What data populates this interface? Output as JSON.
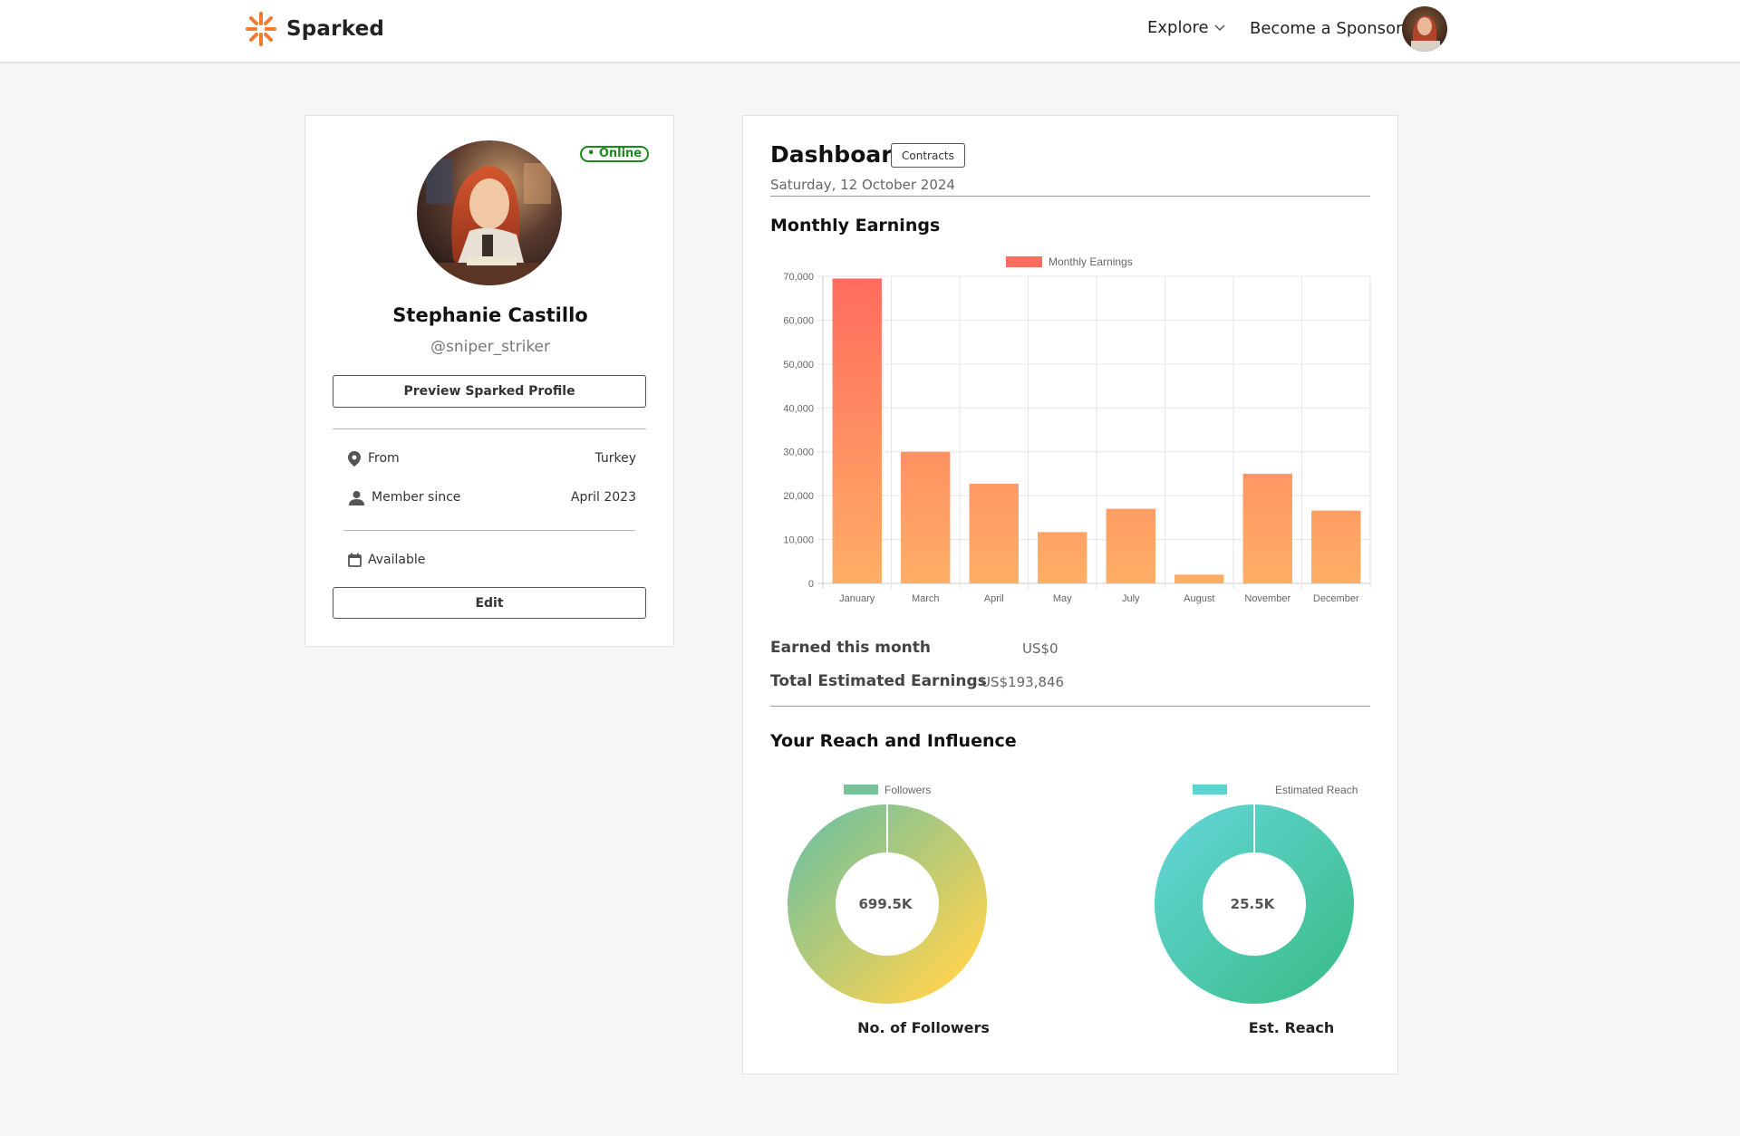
{
  "header": {
    "brand": "Sparked",
    "nav_explore": "Explore",
    "nav_sponsor": "Become a Sponsor",
    "brand_color": "#f47a2d"
  },
  "profile": {
    "status": "• Online",
    "name": "Stephanie Castillo",
    "handle": "@sniper_striker",
    "preview_button": "Preview Sparked Profile",
    "from_label": "From",
    "from_value": "Turkey",
    "member_label": "Member since",
    "member_value": "April 2023",
    "availability": "Available",
    "edit_button": "Edit"
  },
  "dashboard": {
    "title": "Dashboard",
    "contracts_button": "Contracts",
    "date": "Saturday, 12 October 2024",
    "monthly_title": "Monthly Earnings",
    "earned_month_label": "Earned this month",
    "earned_month_value": "US$0",
    "total_label": "Total Estimated Earnings",
    "total_value": "US$193,846",
    "reach_title": "Your Reach and Influence",
    "followers_caption": "No. of Followers",
    "reach_caption": "Est. Reach"
  },
  "chart_data": [
    {
      "type": "bar",
      "legend": "Monthly Earnings",
      "categories": [
        "January",
        "March",
        "April",
        "May",
        "July",
        "August",
        "November",
        "December"
      ],
      "series": [
        {
          "name": "Monthly Earnings",
          "values": [
            69500,
            30000,
            22700,
            11700,
            17000,
            2000,
            25000,
            16600
          ]
        }
      ],
      "ylim": [
        0,
        70000
      ],
      "yticks": [
        "70,000",
        "60,000",
        "50,000",
        "40,000",
        "30,000",
        "20,000",
        "10,000",
        "0"
      ],
      "grid": true,
      "legend_position": "top"
    },
    {
      "type": "pie",
      "legend": "Followers",
      "center_label": "699.5K",
      "value": 699.5,
      "colors": [
        "#78c29a",
        "#ffd34e"
      ]
    },
    {
      "type": "pie",
      "legend": "Estimated Reach",
      "center_label": "25.5K",
      "value": 25.5,
      "colors": [
        "#5fd3d0",
        "#3dbf8e"
      ]
    }
  ]
}
